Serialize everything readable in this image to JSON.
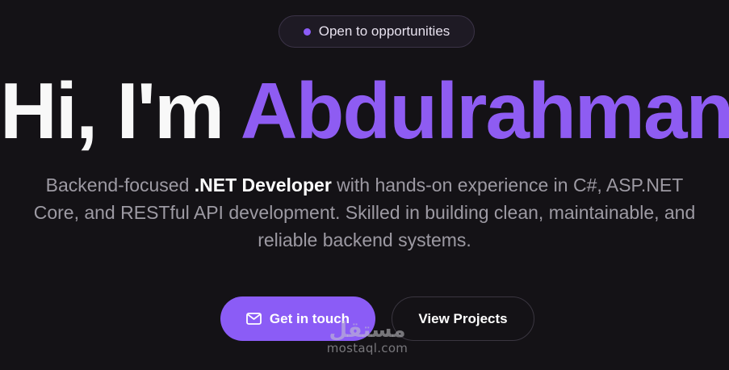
{
  "badge": {
    "label": "Open to opportunities",
    "dot_color": "#8b5cf6"
  },
  "hero": {
    "greeting": "Hi, I'm ",
    "name": "Abdulrahman",
    "accent_color": "#8e5cf2",
    "description_before": "Backend-focused ",
    "description_strong": ".NET Developer",
    "description_after": " with hands-on experience in C#, ASP.NET Core, and RESTful API development. Skilled in building clean, maintainable, and reliable backend systems."
  },
  "actions": {
    "primary_label": "Get in touch",
    "primary_icon": "mail-icon",
    "secondary_label": "View Projects"
  },
  "watermark": {
    "arabic": "مستقل",
    "url": "mostaql.com"
  }
}
